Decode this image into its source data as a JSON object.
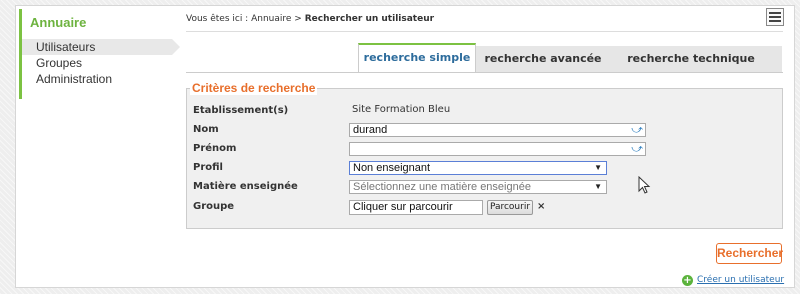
{
  "sidebar": {
    "title": "Annuaire",
    "items": [
      {
        "label": "Utilisateurs"
      },
      {
        "label": "Groupes"
      },
      {
        "label": "Administration"
      }
    ]
  },
  "breadcrumb": {
    "prefix": "Vous êtes ici :",
    "parent": "Annuaire",
    "separator": ">",
    "current": "Rechercher un utilisateur"
  },
  "tabs": [
    {
      "label": "recherche simple"
    },
    {
      "label": "recherche avancée"
    },
    {
      "label": "recherche technique"
    }
  ],
  "criteria": {
    "legend": "Critères de recherche",
    "etablissement_label": "Etablissement(s)",
    "etablissement_value": "Site Formation Bleu",
    "nom_label": "Nom",
    "nom_value": "durand",
    "prenom_label": "Prénom",
    "prenom_value": "",
    "profil_label": "Profil",
    "profil_value": "Non enseignant",
    "matiere_label": "Matière enseignée",
    "matiere_placeholder": "Sélectionnez une matière enseignée",
    "groupe_label": "Groupe",
    "groupe_value": "Cliquer sur parcourir",
    "parcourir_label": "Parcourir",
    "clear_label": "×"
  },
  "actions": {
    "search_label": "Rechercher",
    "create_label": "Créer un utilisateur"
  },
  "colors": {
    "accent_green": "#7cc242",
    "accent_orange": "#e86f2c",
    "tab_active_text": "#2d6c9c",
    "link_blue": "#2a6fb0"
  },
  "icons": {
    "menu": "hamburger-menu-icon",
    "picker": "picker-arrow-icon",
    "dropdown": "chevron-down-icon",
    "create": "plus-circle-icon"
  }
}
